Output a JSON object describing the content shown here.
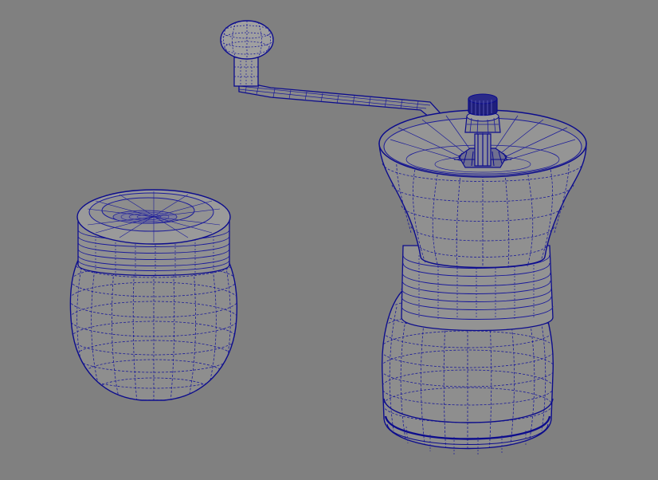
{
  "scene": {
    "viewport_bg": "#808080",
    "surface_fill": "#8c8c8c",
    "surface_fill_light": "#9a9a9a",
    "surface_fill_dark": "#6e6e6e",
    "wire_color": "#0c0c8c",
    "objects": [
      "grinder-jar",
      "grinder-body",
      "crank-handle"
    ]
  }
}
